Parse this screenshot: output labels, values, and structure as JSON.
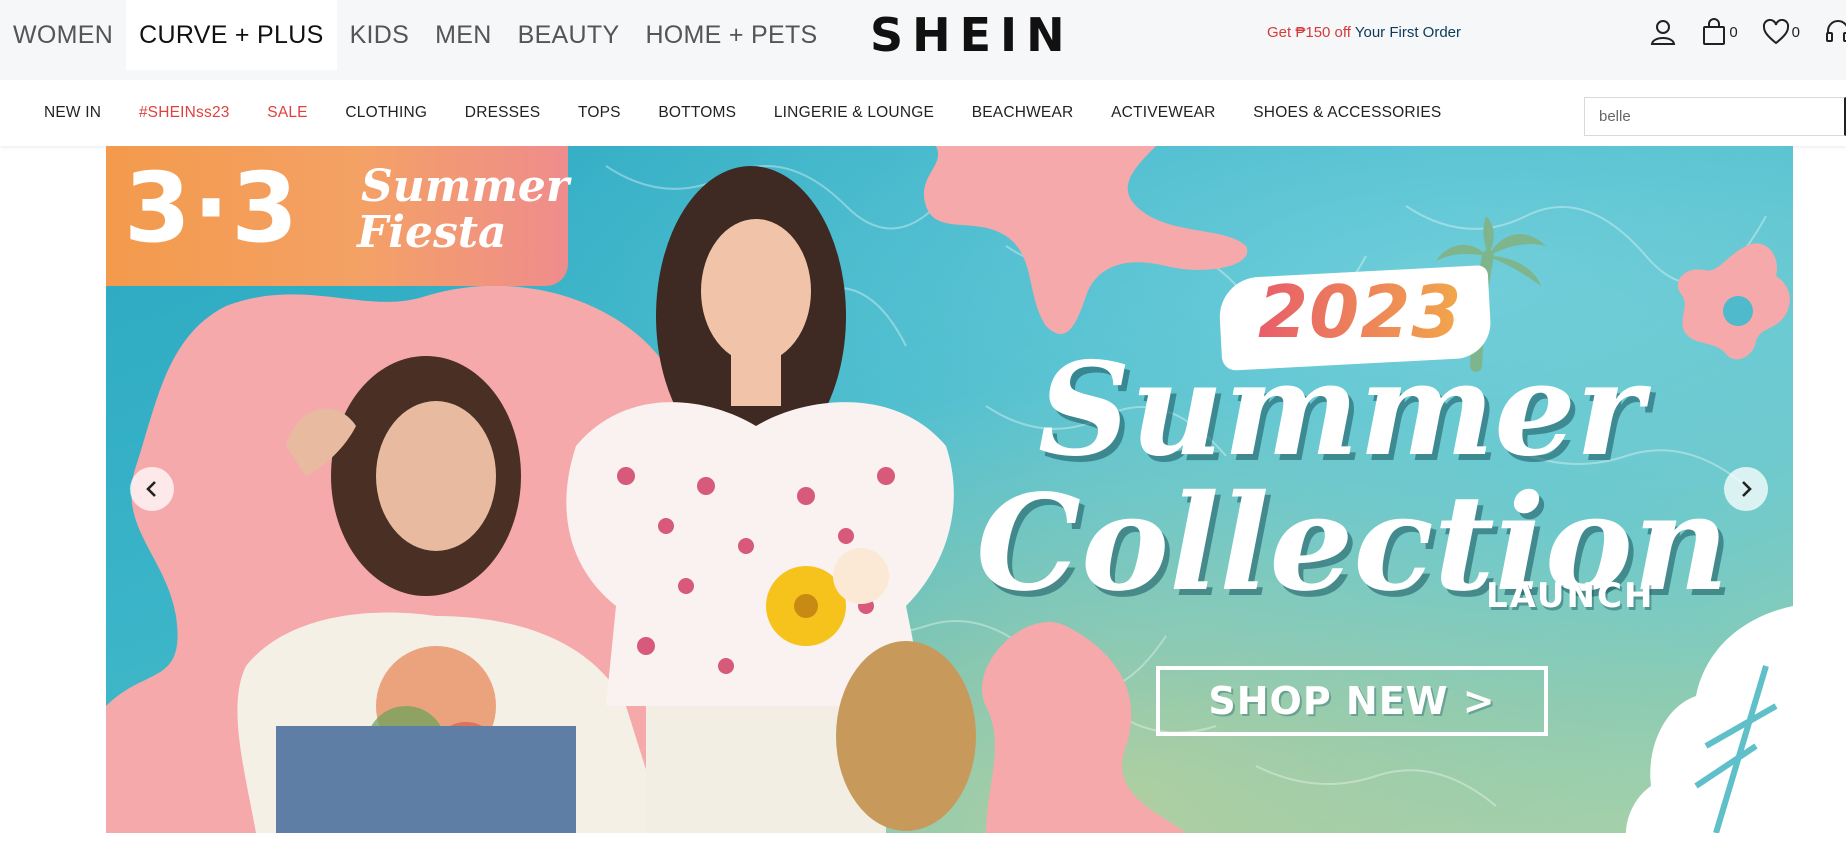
{
  "header": {
    "categories": [
      {
        "label": "WOMEN",
        "active": false
      },
      {
        "label": "CURVE + PLUS",
        "active": true
      },
      {
        "label": "KIDS",
        "active": false
      },
      {
        "label": "MEN",
        "active": false
      },
      {
        "label": "BEAUTY",
        "active": false
      },
      {
        "label": "HOME + PETS",
        "active": false
      }
    ],
    "logo": "SHEIN",
    "promo": {
      "highlight": "Get ₱150 off",
      "rest": " Your First Order"
    },
    "icons": {
      "account": "user-icon",
      "cart": "bag-icon",
      "cart_count": "0",
      "wishlist": "heart-icon",
      "wishlist_count": "0",
      "support": "headset-icon"
    }
  },
  "nav": {
    "items": [
      {
        "label": "NEW IN",
        "hot": false
      },
      {
        "label": "#SHEINss23",
        "hot": true
      },
      {
        "label": "SALE",
        "hot": true
      },
      {
        "label": "CLOTHING",
        "hot": false
      },
      {
        "label": "DRESSES",
        "hot": false
      },
      {
        "label": "TOPS",
        "hot": false
      },
      {
        "label": "BOTTOMS",
        "hot": false
      },
      {
        "label": "LINGERIE & LOUNGE",
        "hot": false
      },
      {
        "label": "BEACHWEAR",
        "hot": false
      },
      {
        "label": "ACTIVEWEAR",
        "hot": false
      },
      {
        "label": "SHOES & ACCESSORIES",
        "hot": false
      }
    ],
    "search": {
      "value": "belle"
    }
  },
  "banner": {
    "badge_number": "3·3",
    "badge_line1": "Summer",
    "badge_line2": "Fiesta",
    "year": "2023",
    "headline_line1": "Summer",
    "headline_line2": "Collection",
    "subline": "LAUNCH",
    "cta": "SHOP NEW >",
    "prev_icon": "chevron-left-icon",
    "next_icon": "chevron-right-icon"
  },
  "colors": {
    "accent_red": "#e0413f",
    "promo_text": "#0c3a5a",
    "topbar_bg": "#f6f7f9",
    "banner_water": "#3cb5c8",
    "banner_pink": "#f6a9aa",
    "badge_orange": "#f39a4c"
  }
}
